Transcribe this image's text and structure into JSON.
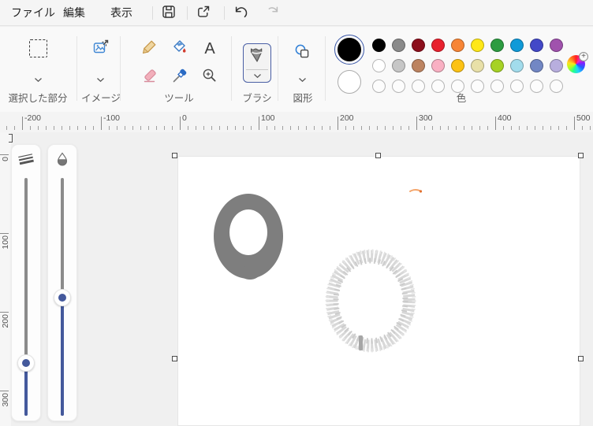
{
  "menu": {
    "items": [
      {
        "label": "ファイル"
      },
      {
        "label": "編集"
      },
      {
        "label": "表示"
      }
    ],
    "buttons": [
      {
        "name": "save",
        "enabled": true
      },
      {
        "name": "share",
        "enabled": true
      },
      {
        "name": "undo",
        "enabled": true
      },
      {
        "name": "redo",
        "enabled": false
      }
    ]
  },
  "toolbar": {
    "groups": [
      {
        "label": "選択した部分"
      },
      {
        "label": "イメージ"
      },
      {
        "label": "ツール"
      },
      {
        "label": "ブラシ"
      },
      {
        "label": "図形"
      },
      {
        "label": "色"
      }
    ],
    "tools": [
      "pencil",
      "fill",
      "text",
      "eraser",
      "eyedropper",
      "magnifier"
    ]
  },
  "colors": {
    "foreground": "#000000",
    "background": "#ffffff",
    "accent": "#44599c",
    "rows": [
      [
        "#000000",
        "#8a8a8a",
        "#8c0f1c",
        "#e8212e",
        "#f78536",
        "#ffe817",
        "#2d9c41",
        "#0f9ad8",
        "#4348c8",
        "#a052ad"
      ],
      [
        "#ffffff",
        "#c6c6c6",
        "#bc8360",
        "#f9b0c3",
        "#fcc214",
        "#e8e0a8",
        "#a6d225",
        "#a2dcec",
        "#7287c4",
        "#b8aede"
      ],
      [
        null,
        null,
        null,
        null,
        null,
        null,
        null,
        null,
        null,
        null
      ]
    ]
  },
  "rulers": {
    "horizontal": {
      "labels": [
        "-200",
        "-100",
        "0",
        "100",
        "200",
        "300",
        "400",
        "500"
      ]
    },
    "vertical": {
      "labels": [
        "0",
        "100",
        "200",
        "300"
      ]
    }
  },
  "sliders": [
    {
      "name": "stroke-width"
    },
    {
      "name": "opacity"
    }
  ],
  "canvas": {
    "marker_color": "#7e7e7e",
    "spray_color": "#d8d8d8",
    "spray_color2": "#cccccc",
    "spray_color3": "#e4e4e4",
    "spray_speck_color": "#a6a6a6",
    "dash_color": "#f4a469",
    "dash_dot_color": "#e2712f"
  }
}
